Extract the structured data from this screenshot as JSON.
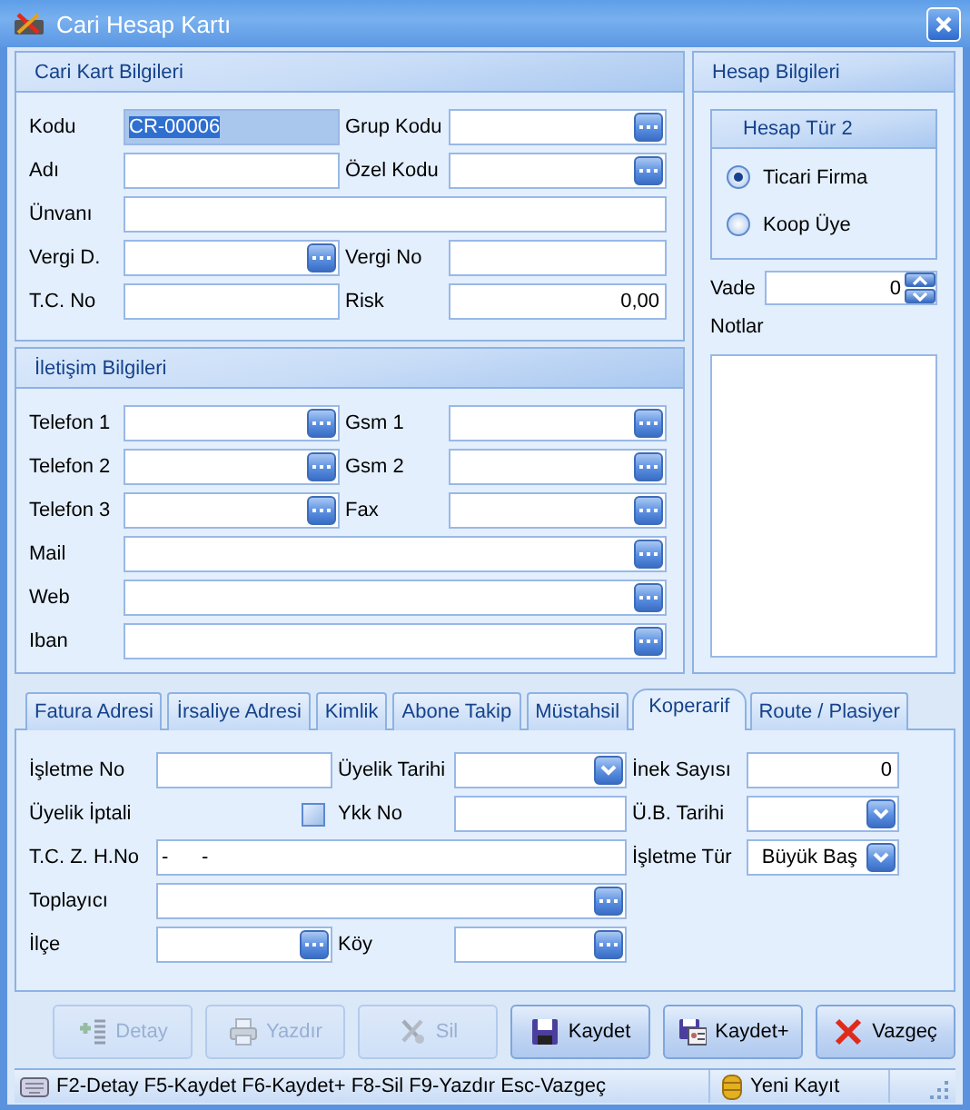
{
  "window": {
    "title": "Cari Hesap Kartı"
  },
  "cari_kart": {
    "title": "Cari Kart Bilgileri",
    "rows": [
      [
        {
          "label": "Kodu",
          "kind": "text",
          "value": "CR-00006",
          "focused": true
        },
        {
          "label": "Grup Kodu",
          "kind": "lookup",
          "focused": false
        }
      ],
      [
        {
          "label": "Adı",
          "kind": "text",
          "focused": false
        },
        {
          "label": "Özel Kodu",
          "kind": "lookup",
          "focused": false
        }
      ],
      [
        {
          "label": "Ünvanı",
          "kind": "text-wide",
          "focused": false
        }
      ],
      [
        {
          "label": "Vergi D.",
          "kind": "lookup",
          "focused": false
        },
        {
          "label": "Vergi No",
          "kind": "text",
          "focused": false
        }
      ],
      [
        {
          "label": "T.C. No",
          "kind": "text",
          "focused": false
        },
        {
          "label": "Risk",
          "kind": "number",
          "value": "0,00",
          "focused": false
        }
      ]
    ]
  },
  "iletisim": {
    "title": "İletişim Bilgileri",
    "rows": [
      [
        {
          "label": "Telefon 1",
          "kind": "lookup"
        },
        {
          "label": "Gsm 1",
          "kind": "lookup"
        }
      ],
      [
        {
          "label": "Telefon 2",
          "kind": "lookup"
        },
        {
          "label": "Gsm 2",
          "kind": "lookup"
        }
      ],
      [
        {
          "label": "Telefon 3",
          "kind": "lookup"
        },
        {
          "label": "Fax",
          "kind": "lookup"
        }
      ],
      [
        {
          "label": "Mail",
          "kind": "lookup-wide"
        }
      ],
      [
        {
          "label": "Web",
          "kind": "lookup-wide"
        }
      ],
      [
        {
          "label": "Iban",
          "kind": "lookup-wide"
        }
      ]
    ]
  },
  "hesap": {
    "title": "Hesap Bilgileri",
    "type_group": {
      "title": "Hesap Tür 2",
      "options": [
        {
          "label": "Ticari Firma",
          "selected": true
        },
        {
          "label": "Koop Üye",
          "selected": false
        }
      ]
    },
    "vade": {
      "label": "Vade",
      "value": "0"
    },
    "notes": {
      "label": "Notlar"
    }
  },
  "tabs": [
    {
      "label": "Fatura Adresi",
      "selected": false
    },
    {
      "label": "İrsaliye Adresi",
      "selected": false
    },
    {
      "label": "Kimlik",
      "selected": false
    },
    {
      "label": "Abone Takip",
      "selected": false
    },
    {
      "label": "Müstahsil",
      "selected": false
    },
    {
      "label": "Koperarif",
      "selected": true
    },
    {
      "label": "Route / Plasiyer",
      "selected": false
    }
  ],
  "koperarif": {
    "rows": [
      [
        {
          "label": "İşletme No",
          "kind": "text"
        },
        {
          "label": "Üyelik Tarihi",
          "kind": "dropdown"
        },
        {
          "label": "İnek Sayısı",
          "kind": "number",
          "value": "0"
        }
      ],
      [
        {
          "label": "Üyelik İptali",
          "kind": "checkbox",
          "checked": false
        },
        {
          "label": "Ykk No",
          "kind": "text"
        },
        {
          "label": "Ü.B. Tarihi",
          "kind": "dropdown"
        }
      ],
      [
        {
          "label": "T.C. Z. H.No",
          "kind": "text-wide",
          "value": "-      -"
        },
        null,
        {
          "label": "İşletme Tür",
          "kind": "dropdown",
          "value": "Büyük Baş"
        }
      ],
      [
        {
          "label": "Toplayıcı",
          "kind": "lookup-wide"
        }
      ],
      [
        {
          "label": "İlçe",
          "kind": "lookup"
        },
        {
          "label": "Köy",
          "kind": "lookup"
        }
      ]
    ]
  },
  "buttons": [
    {
      "label": "Detay",
      "kind": "detail",
      "disabled": true
    },
    {
      "label": "Yazdır",
      "kind": "print",
      "disabled": true
    },
    {
      "label": "Sil",
      "kind": "delete",
      "disabled": true
    },
    {
      "label": "Kaydet",
      "kind": "save",
      "disabled": false
    },
    {
      "label": "Kaydet+",
      "kind": "save-plus",
      "disabled": false
    },
    {
      "label": "Vazgeç",
      "kind": "cancel",
      "disabled": false
    }
  ],
  "status_bar": {
    "shortcuts": "F2-Detay F5-Kaydet F6-Kaydet+ F8-Sil F9-Yazdır Esc-Vazgeç",
    "record_state": "Yeni Kayıt"
  }
}
